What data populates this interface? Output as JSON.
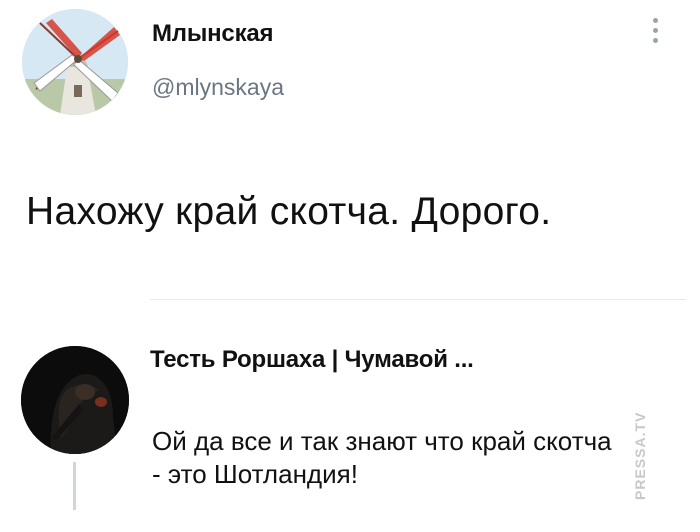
{
  "tweet": {
    "author_name": "Млынская",
    "author_handle": "@mlynskaya",
    "text": "Нахожу край скотча. Дорого.",
    "avatar_icon": "windmill-avatar-icon",
    "menu_icon": "more-vertical-icon"
  },
  "reply": {
    "author_name": "Тесть Роршаха | Чумавой ...",
    "text_line1": "Ой да все и так знают что край скотча",
    "text_line2": "- это Шотландия!",
    "avatar_icon": "plague-doctor-avatar-icon"
  },
  "watermark": "PRESSA.TV",
  "colors": {
    "background": "#ffffff",
    "text": "#111111",
    "handle": "#6b7680",
    "divider": "#e7ebee",
    "thread_line": "#cfd6dc"
  }
}
